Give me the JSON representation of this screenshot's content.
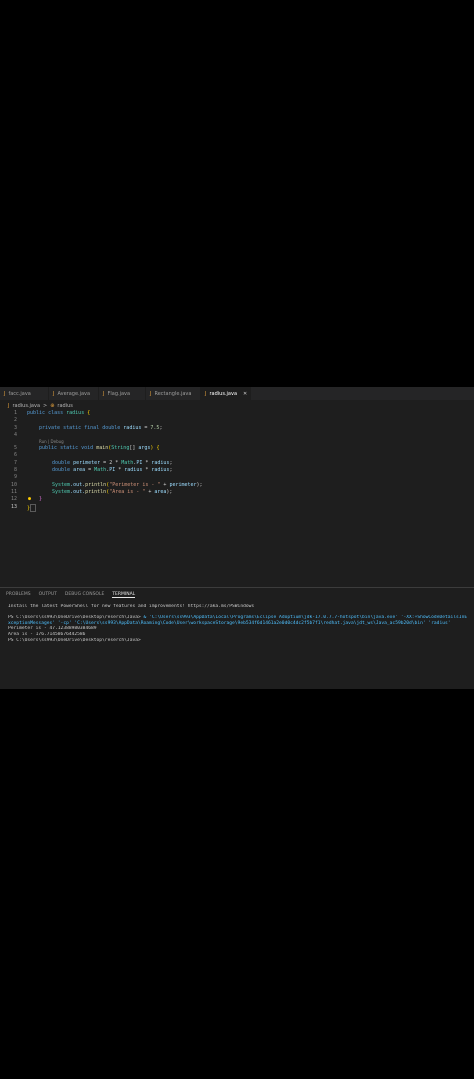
{
  "tabs": [
    {
      "label": "facc.java",
      "active": false
    },
    {
      "label": "Average.java",
      "active": false
    },
    {
      "label": "Flag.java",
      "active": false
    },
    {
      "label": "Rectangle.java",
      "active": false
    },
    {
      "label": "radius.java",
      "active": true
    }
  ],
  "breadcrumb": {
    "file": "radius.java",
    "separator": ">",
    "symbol": "radius"
  },
  "line_numbers": [
    "1",
    "2",
    "3",
    "4",
    "5",
    "6",
    "7",
    "8",
    "9",
    "10",
    "11",
    "12",
    "13"
  ],
  "code": {
    "l1": {
      "kw": "public class",
      "name": "radius",
      "brace": "{"
    },
    "l3": {
      "kw": "private static final double",
      "name": "radius",
      "op": "=",
      "val": "7.5",
      "end": ";"
    },
    "codelens": "Run | Debug",
    "l5": {
      "kw": "public static void",
      "fn": "main",
      "open": "(",
      "ty": "String",
      "arr": "[] ",
      "arg": "args",
      "close": ")",
      "brace": "{"
    },
    "l7": {
      "ty": "double",
      "var": "perimeter",
      "expr1": " = 2 * ",
      "cls": "Math",
      "dot": ".",
      "pi": "PI",
      "expr2": " * ",
      "r": "radius",
      "end": ";"
    },
    "l8": {
      "ty": "double",
      "var": "area",
      "expr1": " = ",
      "cls": "Math",
      "dot": ".",
      "pi": "PI",
      "expr2": " * ",
      "r1": "radius",
      "mul": " * ",
      "r2": "radius",
      "end": ";"
    },
    "l10": {
      "cls": "System",
      "out": ".out.",
      "fn": "println",
      "open": "(",
      "str": "\"Perimeter is - \"",
      "plus": " + ",
      "var": "perimeter",
      "close": ");"
    },
    "l11": {
      "cls": "System",
      "out": ".out.",
      "fn": "println",
      "open": "(",
      "str": "\"Area is - \"",
      "plus": " + ",
      "var": "area",
      "close": ");"
    },
    "l12": {
      "brace": "}"
    },
    "l13": {
      "brace": "}"
    }
  },
  "panel": {
    "tabs": [
      "PROBLEMS",
      "OUTPUT",
      "DEBUG CONSOLE",
      "TERMINAL"
    ],
    "active": "TERMINAL"
  },
  "terminal": {
    "l1": "Install the latest PowerShell for new features and improvements! https://aka.ms/PSWindows",
    "l2_prompt": "PS C:\\Users\\ss993\\OneDrive\\Desktop\\reserch\\Java> ",
    "l2_cmd": " & 'C:\\Users\\ss993\\AppData\\Local\\Programs\\Eclipse Adoptium\\jdk-17.0.7.7-hotspot\\bin\\java.exe' '-XX:+ShowCodeDetailsInExceptionMessages' '-cp' 'C:\\Users\\ss993\\AppData\\Roaming\\Code\\User\\workspaceStorage\\9eb534f6d1461a2e0d0c4dc2f5b7f1\\redhat.java\\jdt_ws\\Java_ac59b20d\\bin' 'radius'",
    "l3": "Perimeter is - 47.12388980384689",
    "l4": "Area is - 176.71458676442586",
    "l5": "PS C:\\Users\\ss993\\OneDrive\\Desktop\\reserch\\Java>"
  }
}
